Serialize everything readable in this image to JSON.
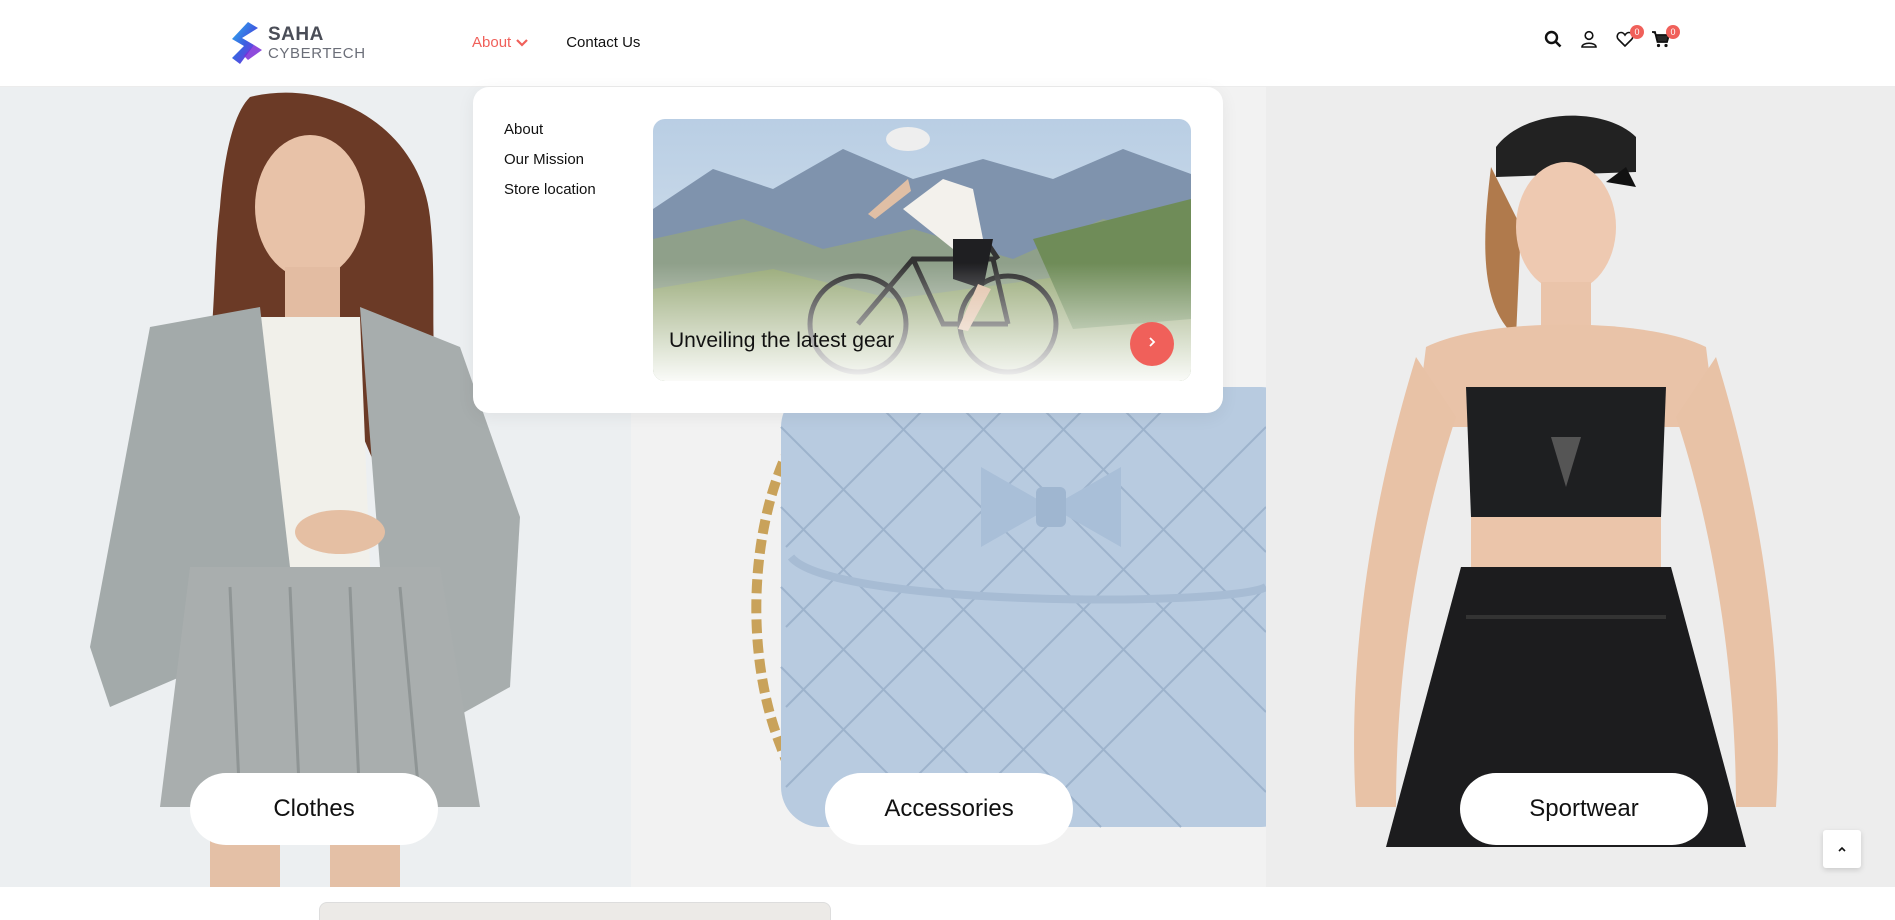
{
  "brand": {
    "line1": "SAHA",
    "line2": "CYBERTECH",
    "accent": "#f0605a"
  },
  "nav": {
    "about": "About",
    "contact": "Contact Us"
  },
  "header_icons": {
    "wishlist_count": "0",
    "cart_count": "0"
  },
  "dropdown": {
    "links": [
      "About",
      "Our Mission",
      "Store location"
    ],
    "promo_title": "Unveiling the latest gear"
  },
  "categories": [
    "Clothes",
    "Accessories",
    "Sportwear"
  ]
}
